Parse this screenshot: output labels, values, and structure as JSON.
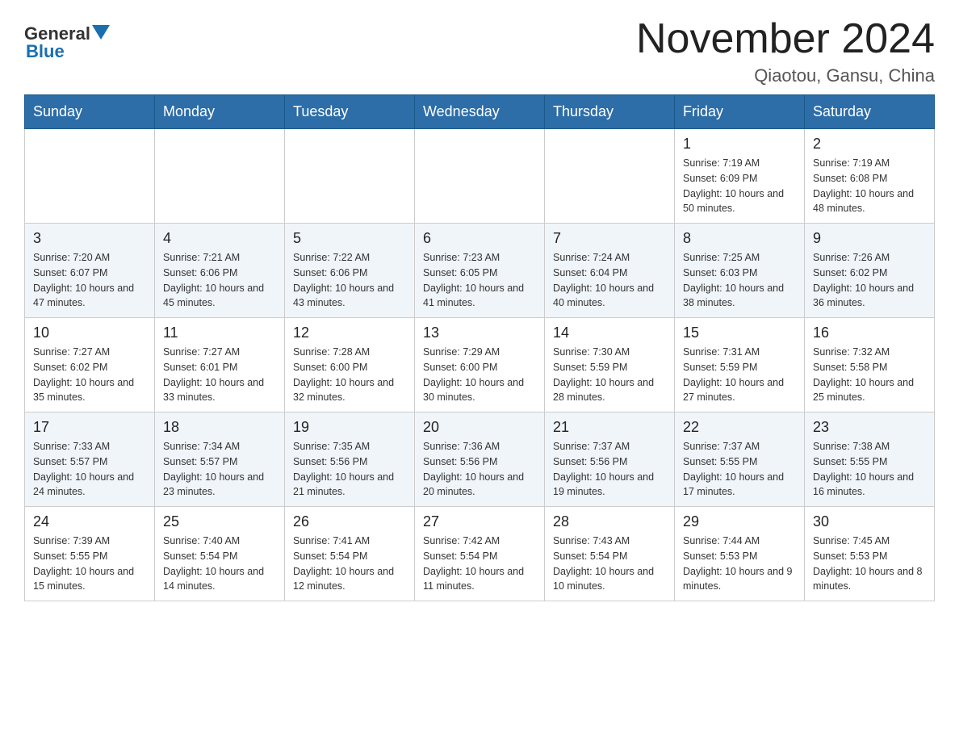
{
  "header": {
    "logo_general": "General",
    "logo_blue": "Blue",
    "title": "November 2024",
    "subtitle": "Qiaotou, Gansu, China"
  },
  "weekdays": [
    "Sunday",
    "Monday",
    "Tuesday",
    "Wednesday",
    "Thursday",
    "Friday",
    "Saturday"
  ],
  "rows": [
    {
      "cells": [
        {
          "day": "",
          "info": ""
        },
        {
          "day": "",
          "info": ""
        },
        {
          "day": "",
          "info": ""
        },
        {
          "day": "",
          "info": ""
        },
        {
          "day": "",
          "info": ""
        },
        {
          "day": "1",
          "info": "Sunrise: 7:19 AM\nSunset: 6:09 PM\nDaylight: 10 hours\nand 50 minutes."
        },
        {
          "day": "2",
          "info": "Sunrise: 7:19 AM\nSunset: 6:08 PM\nDaylight: 10 hours\nand 48 minutes."
        }
      ]
    },
    {
      "cells": [
        {
          "day": "3",
          "info": "Sunrise: 7:20 AM\nSunset: 6:07 PM\nDaylight: 10 hours\nand 47 minutes."
        },
        {
          "day": "4",
          "info": "Sunrise: 7:21 AM\nSunset: 6:06 PM\nDaylight: 10 hours\nand 45 minutes."
        },
        {
          "day": "5",
          "info": "Sunrise: 7:22 AM\nSunset: 6:06 PM\nDaylight: 10 hours\nand 43 minutes."
        },
        {
          "day": "6",
          "info": "Sunrise: 7:23 AM\nSunset: 6:05 PM\nDaylight: 10 hours\nand 41 minutes."
        },
        {
          "day": "7",
          "info": "Sunrise: 7:24 AM\nSunset: 6:04 PM\nDaylight: 10 hours\nand 40 minutes."
        },
        {
          "day": "8",
          "info": "Sunrise: 7:25 AM\nSunset: 6:03 PM\nDaylight: 10 hours\nand 38 minutes."
        },
        {
          "day": "9",
          "info": "Sunrise: 7:26 AM\nSunset: 6:02 PM\nDaylight: 10 hours\nand 36 minutes."
        }
      ]
    },
    {
      "cells": [
        {
          "day": "10",
          "info": "Sunrise: 7:27 AM\nSunset: 6:02 PM\nDaylight: 10 hours\nand 35 minutes."
        },
        {
          "day": "11",
          "info": "Sunrise: 7:27 AM\nSunset: 6:01 PM\nDaylight: 10 hours\nand 33 minutes."
        },
        {
          "day": "12",
          "info": "Sunrise: 7:28 AM\nSunset: 6:00 PM\nDaylight: 10 hours\nand 32 minutes."
        },
        {
          "day": "13",
          "info": "Sunrise: 7:29 AM\nSunset: 6:00 PM\nDaylight: 10 hours\nand 30 minutes."
        },
        {
          "day": "14",
          "info": "Sunrise: 7:30 AM\nSunset: 5:59 PM\nDaylight: 10 hours\nand 28 minutes."
        },
        {
          "day": "15",
          "info": "Sunrise: 7:31 AM\nSunset: 5:59 PM\nDaylight: 10 hours\nand 27 minutes."
        },
        {
          "day": "16",
          "info": "Sunrise: 7:32 AM\nSunset: 5:58 PM\nDaylight: 10 hours\nand 25 minutes."
        }
      ]
    },
    {
      "cells": [
        {
          "day": "17",
          "info": "Sunrise: 7:33 AM\nSunset: 5:57 PM\nDaylight: 10 hours\nand 24 minutes."
        },
        {
          "day": "18",
          "info": "Sunrise: 7:34 AM\nSunset: 5:57 PM\nDaylight: 10 hours\nand 23 minutes."
        },
        {
          "day": "19",
          "info": "Sunrise: 7:35 AM\nSunset: 5:56 PM\nDaylight: 10 hours\nand 21 minutes."
        },
        {
          "day": "20",
          "info": "Sunrise: 7:36 AM\nSunset: 5:56 PM\nDaylight: 10 hours\nand 20 minutes."
        },
        {
          "day": "21",
          "info": "Sunrise: 7:37 AM\nSunset: 5:56 PM\nDaylight: 10 hours\nand 19 minutes."
        },
        {
          "day": "22",
          "info": "Sunrise: 7:37 AM\nSunset: 5:55 PM\nDaylight: 10 hours\nand 17 minutes."
        },
        {
          "day": "23",
          "info": "Sunrise: 7:38 AM\nSunset: 5:55 PM\nDaylight: 10 hours\nand 16 minutes."
        }
      ]
    },
    {
      "cells": [
        {
          "day": "24",
          "info": "Sunrise: 7:39 AM\nSunset: 5:55 PM\nDaylight: 10 hours\nand 15 minutes."
        },
        {
          "day": "25",
          "info": "Sunrise: 7:40 AM\nSunset: 5:54 PM\nDaylight: 10 hours\nand 14 minutes."
        },
        {
          "day": "26",
          "info": "Sunrise: 7:41 AM\nSunset: 5:54 PM\nDaylight: 10 hours\nand 12 minutes."
        },
        {
          "day": "27",
          "info": "Sunrise: 7:42 AM\nSunset: 5:54 PM\nDaylight: 10 hours\nand 11 minutes."
        },
        {
          "day": "28",
          "info": "Sunrise: 7:43 AM\nSunset: 5:54 PM\nDaylight: 10 hours\nand 10 minutes."
        },
        {
          "day": "29",
          "info": "Sunrise: 7:44 AM\nSunset: 5:53 PM\nDaylight: 10 hours\nand 9 minutes."
        },
        {
          "day": "30",
          "info": "Sunrise: 7:45 AM\nSunset: 5:53 PM\nDaylight: 10 hours\nand 8 minutes."
        }
      ]
    }
  ]
}
